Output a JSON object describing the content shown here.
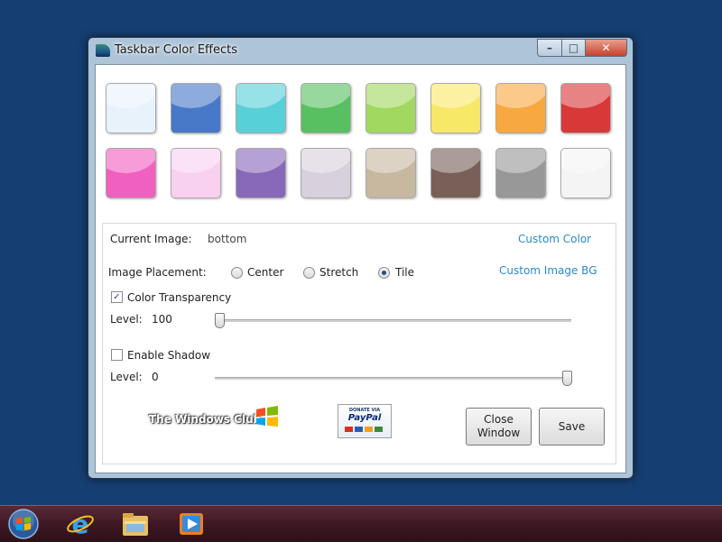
{
  "window": {
    "title": "Taskbar Color Effects",
    "controls": {
      "minimize": "–",
      "maximize": "□",
      "close": "✕"
    }
  },
  "swatches": {
    "row1": [
      "#e8f2fb",
      "#4878c8",
      "#58d0d8",
      "#58c060",
      "#a0d860",
      "#f8e868",
      "#f8a840",
      "#d83838"
    ],
    "row2": [
      "#f060c0",
      "#f8d0f0",
      "#8868b8",
      "#d8d0dc",
      "#c8b8a0",
      "#786058",
      "#989898",
      "#f4f4f4"
    ]
  },
  "settings": {
    "current_image_label": "Current Image:",
    "current_image_value": "bottom",
    "custom_color_link": "Custom Color",
    "placement_label": "Image Placement:",
    "placement_options": [
      "Center",
      "Stretch",
      "Tile"
    ],
    "placement_selected": "Tile",
    "custom_image_bg_link": "Custom Image BG",
    "transparency_label": "Color Transparency",
    "transparency_checked": true,
    "level_label": "Level:",
    "transparency_level": "100",
    "shadow_label": "Enable Shadow",
    "shadow_checked": false,
    "shadow_level": "0"
  },
  "branding": {
    "club_text": "The Windows Club",
    "paypal_top": "DONATE VIA",
    "paypal_name": "PayPal"
  },
  "buttons": {
    "close_window": "Close Window",
    "save": "Save"
  },
  "taskbar": {
    "items": [
      "start-orb",
      "internet-explorer",
      "file-explorer",
      "media-player"
    ]
  }
}
